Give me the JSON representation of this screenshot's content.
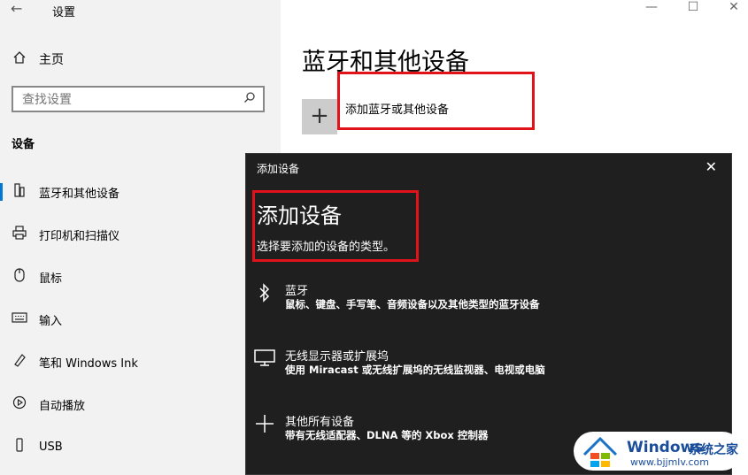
{
  "window": {
    "back_glyph": "←",
    "title": "设置",
    "minimize_glyph": "—",
    "maximize_glyph": "☐",
    "close_glyph": "✕"
  },
  "sidebar": {
    "home_label": "主页",
    "search_placeholder": "查找设置",
    "section_title": "设备",
    "items": [
      {
        "label": "蓝牙和其他设备",
        "icon": "bluetooth-devices-icon",
        "active": true
      },
      {
        "label": "打印机和扫描仪",
        "icon": "printer-icon"
      },
      {
        "label": "鼠标",
        "icon": "mouse-icon"
      },
      {
        "label": "输入",
        "icon": "keyboard-icon"
      },
      {
        "label": "笔和 Windows Ink",
        "icon": "pen-icon"
      },
      {
        "label": "自动播放",
        "icon": "autoplay-icon"
      },
      {
        "label": "USB",
        "icon": "usb-icon"
      }
    ]
  },
  "main": {
    "title": "蓝牙和其他设备",
    "add_button_label": "添加蓝牙或其他设备"
  },
  "dialog": {
    "title": "添加设备",
    "close_glyph": "✕",
    "heading": "添加设备",
    "subheading": "选择要添加的设备的类型。",
    "options": [
      {
        "name": "蓝牙",
        "desc": "鼠标、键盘、手写笔、音频设备以及其他类型的蓝牙设备",
        "icon": "bluetooth-icon"
      },
      {
        "name": "无线显示器或扩展坞",
        "desc": "使用 Miracast 或无线扩展坞的无线监视器、电视或电脑",
        "icon": "monitor-icon"
      },
      {
        "name": "其他所有设备",
        "desc": "带有无线适配器、DLNA 等的 Xbox 控制器",
        "icon": "plus-icon"
      }
    ]
  },
  "watermark": {
    "brand": "Windows",
    "site": "系统之家",
    "url": "www.bjjmlv.com"
  },
  "colors": {
    "accent": "#0078d7",
    "highlight_red": "#e0121a",
    "dialog_bg": "#1f1f1f",
    "sidebar_bg": "#f2f2f2"
  }
}
